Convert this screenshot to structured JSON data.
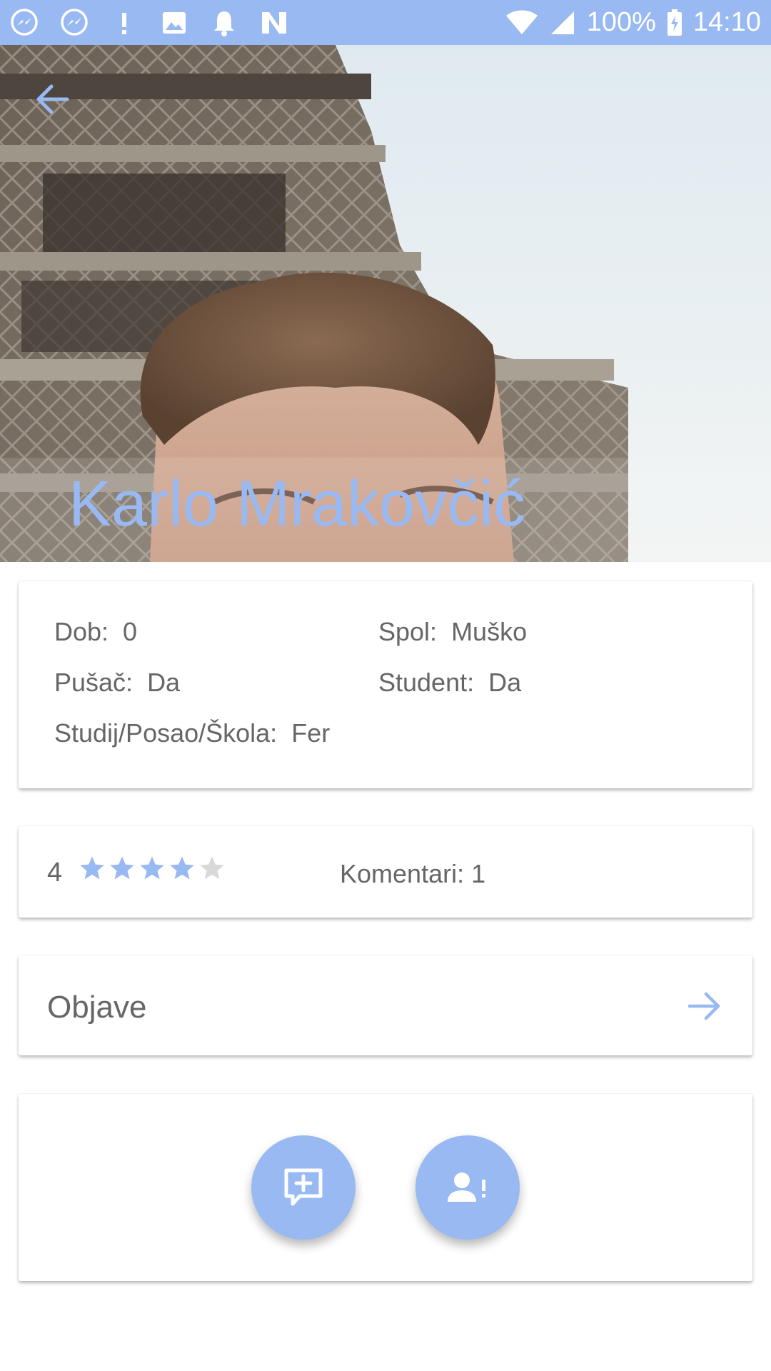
{
  "status_bar": {
    "icons": [
      "messenger-icon",
      "messenger-icon",
      "alert-icon",
      "image-icon",
      "bell-icon",
      "n-icon"
    ],
    "battery": "100%",
    "time": "14:10"
  },
  "header": {
    "back_icon": "arrow-back-icon",
    "name": "Karlo Mrakovčić"
  },
  "info": {
    "age_label": "Dob:",
    "age_value": "0",
    "gender_label": "Spol:",
    "gender_value": "Muško",
    "smoker_label": "Pušač:",
    "smoker_value": "Da",
    "student_label": "Student:",
    "student_value": "Da",
    "occupation_label": "Studij/Posao/Škola:",
    "occupation_value": "Fer"
  },
  "rating": {
    "value": "4",
    "stars_filled": 4,
    "stars_total": 5,
    "comments": "Komentari: 1"
  },
  "posts": {
    "label": "Objave",
    "arrow_icon": "arrow-forward-icon"
  },
  "actions": {
    "comment_icon": "add-comment-icon",
    "report_icon": "report-user-icon"
  },
  "colors": {
    "accent": "#98b9f2",
    "text": "#666666",
    "star_empty": "#d9d9d9"
  }
}
